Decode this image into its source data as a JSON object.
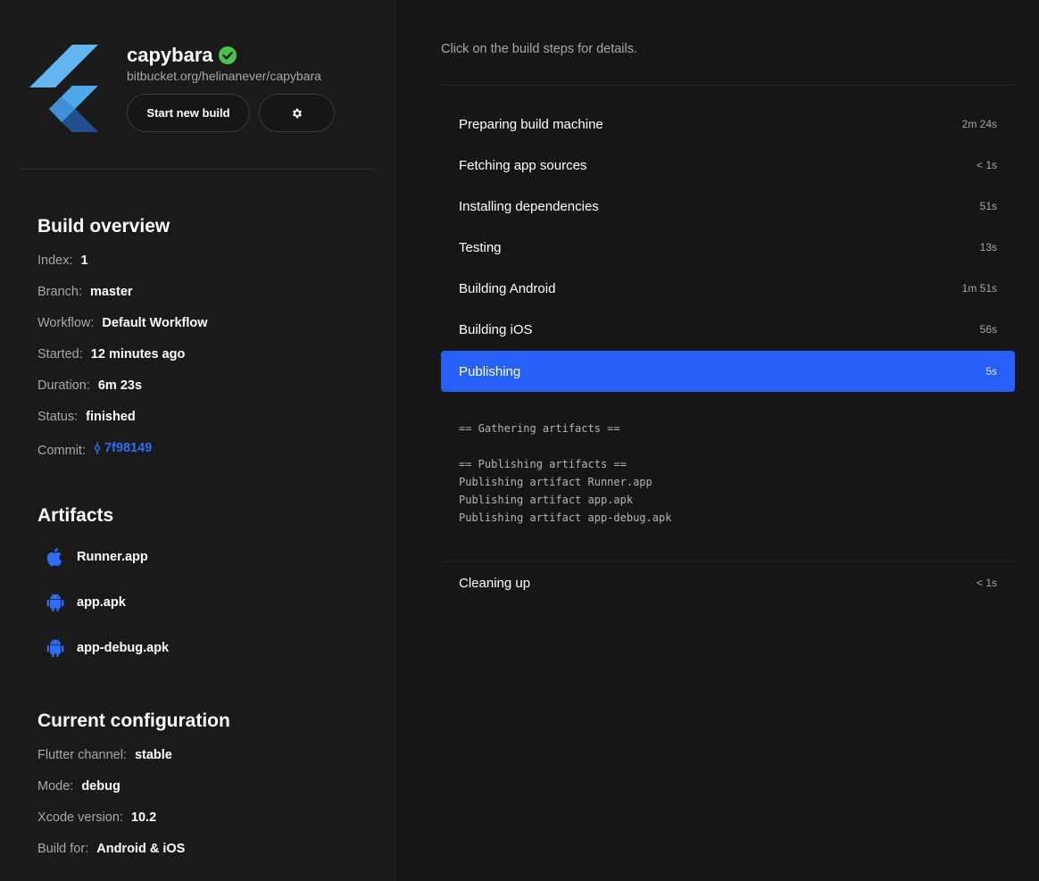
{
  "app": {
    "name": "capybara",
    "url": "bitbucket.org/helinanever/capybara",
    "start_build_label": "Start new build"
  },
  "overview": {
    "title": "Build overview",
    "rows": [
      {
        "key": "Index:",
        "value": "1"
      },
      {
        "key": "Branch:",
        "value": "master"
      },
      {
        "key": "Workflow:",
        "value": "Default Workflow"
      },
      {
        "key": "Started:",
        "value": "12 minutes ago"
      },
      {
        "key": "Duration:",
        "value": "6m 23s"
      },
      {
        "key": "Status:",
        "value": "finished"
      },
      {
        "key": "Commit:",
        "value": "7f98149"
      }
    ]
  },
  "artifacts": {
    "title": "Artifacts",
    "items": [
      {
        "name": "Runner.app",
        "icon": "apple-icon"
      },
      {
        "name": "app.apk",
        "icon": "android-icon"
      },
      {
        "name": "app-debug.apk",
        "icon": "android-icon"
      }
    ]
  },
  "config": {
    "title": "Current configuration",
    "rows": [
      {
        "key": "Flutter channel:",
        "value": "stable"
      },
      {
        "key": "Mode:",
        "value": "debug"
      },
      {
        "key": "Xcode version:",
        "value": "10.2"
      },
      {
        "key": "Build for:",
        "value": "Android & iOS"
      }
    ]
  },
  "main": {
    "hint": "Click on the build steps for details.",
    "steps": [
      {
        "label": "Preparing build machine",
        "duration": "2m 24s"
      },
      {
        "label": "Fetching app sources",
        "duration": "< 1s"
      },
      {
        "label": "Installing dependencies",
        "duration": "51s"
      },
      {
        "label": "Testing",
        "duration": "13s"
      },
      {
        "label": "Building Android",
        "duration": "1m 51s"
      },
      {
        "label": "Building iOS",
        "duration": "56s"
      },
      {
        "label": "Publishing",
        "duration": "5s",
        "active": true
      },
      {
        "label": "Cleaning up",
        "duration": "< 1s"
      }
    ],
    "log": "== Gathering artifacts ==\n\n== Publishing artifacts ==\nPublishing artifact Runner.app\nPublishing artifact app.apk\nPublishing artifact app-debug.apk"
  },
  "colors": {
    "accent": "#2660f6",
    "success": "#4cc24a",
    "background": "#161616"
  }
}
